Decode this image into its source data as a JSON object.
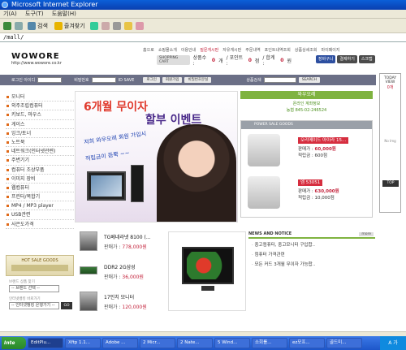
{
  "window": {
    "title": "Microsoft Internet Explorer",
    "menu": [
      "기(A)",
      "도구(T)",
      "도움말(H)"
    ],
    "toolbar": {
      "search_label": "검색",
      "favorites_label": "즐겨찾기"
    },
    "address": "/mall/"
  },
  "site": {
    "logo": "WOWORE",
    "logo_url": "http://www.wowore.co.kr",
    "topnav": [
      "홈으로",
      "쇼핑몰소개",
      "이용안내",
      "질문게시판",
      "자유게시판",
      "주문내역",
      "포인트내역조회",
      "상품상세조회",
      "마이페이지"
    ],
    "topnav_highlight_index": 3,
    "cart_tag": "SHOPPING CART",
    "cart_count_prefix": "상품수 :",
    "cart_count": "0",
    "cart_count_unit": "개",
    "points_prefix": "/ 포인트 :",
    "points": "0",
    "points_unit": "점",
    "total_prefix": "/ 합계 :",
    "total": "0",
    "total_unit": "원",
    "buttons": [
      "장바구니",
      "결제하기",
      "스크랩"
    ]
  },
  "login": {
    "id_label": "로그인 아이디",
    "pw_label": "비밀번호",
    "save_label": "ID SAVE",
    "login_btn": "로그인",
    "join_btn": "회원가입",
    "find_btn": "비밀번호분실",
    "search_label": "상품검색",
    "search_btn": "SEARCH"
  },
  "categories": [
    "모니터",
    "외주조립컴퓨터",
    "키보드, 마우스",
    "게이스",
    "잉크/토너",
    "노트북",
    "네트워크(인터넷관련)",
    "주변기기",
    "컴퓨터 조상부품",
    "이미지 장비",
    "웹컴퓨터",
    "프린터/복합기",
    "MP4 / MP3 player",
    "USB관련",
    "사은도가격"
  ],
  "sidebar_promo": "HOT SALE GOODS",
  "brand_note": "브랜드 상품 찾기",
  "brand_select": "-- 브랜드 선택 --",
  "bank_note": "인터넷뱅킹 바로가기",
  "bank_select": "-- 인터넷뱅킹 은행가기 --",
  "banner": {
    "title": "6개월 무이자",
    "subtitle": "할부 이벤트",
    "hand1": "저희 와우오레 회원 가입시",
    "hand2": "적립금이 듬뿍 ~~"
  },
  "right_box": {
    "header": "와우오레",
    "line1": "온라인 계좌정보",
    "line2": "농협 845-02-246524",
    "deals_header": "POWER SALE GOODS",
    "deals": [
      {
        "tag": "오리메이드 아이라 15...",
        "price_label": "판매가 :",
        "price": "60,000원",
        "points_label": "적립금 :",
        "points": "600점"
      },
      {
        "tag": "엠 53051",
        "price_label": "판매가 :",
        "price": "630,000원",
        "points_label": "적립금 :",
        "points": "10,000점"
      }
    ]
  },
  "today": {
    "label": "TODAY VIEW",
    "count": "0개",
    "empty": "No Img",
    "top": "TOP"
  },
  "products": [
    {
      "name": "TG베네라넷 8100 (...",
      "price_label": "판매가 :",
      "price": "778,000원"
    },
    {
      "name": "DDR2 2G삼성",
      "price_label": "판매가 :",
      "price": "36,000원"
    },
    {
      "name": "17인치 모니터",
      "price_label": "판매가 :",
      "price": "120,000원"
    }
  ],
  "news": {
    "title": "NEWS AND NOTICE",
    "more": "more",
    "items": [
      "중고컴퓨터, 중고모니터 구입합..",
      "컴퓨터 가격관련",
      "모든 커드 3개월 무이자 가능합.."
    ]
  },
  "taskbar": {
    "start": "Inte",
    "tasks": [
      "EditPlu...",
      "Xftp 1.1...",
      "Adobe ...",
      "2 Micr...",
      "2 Nate...",
      "5 Wind...",
      "소회를...",
      "ez모프...",
      "골드미..."
    ],
    "tray": "A 가"
  }
}
